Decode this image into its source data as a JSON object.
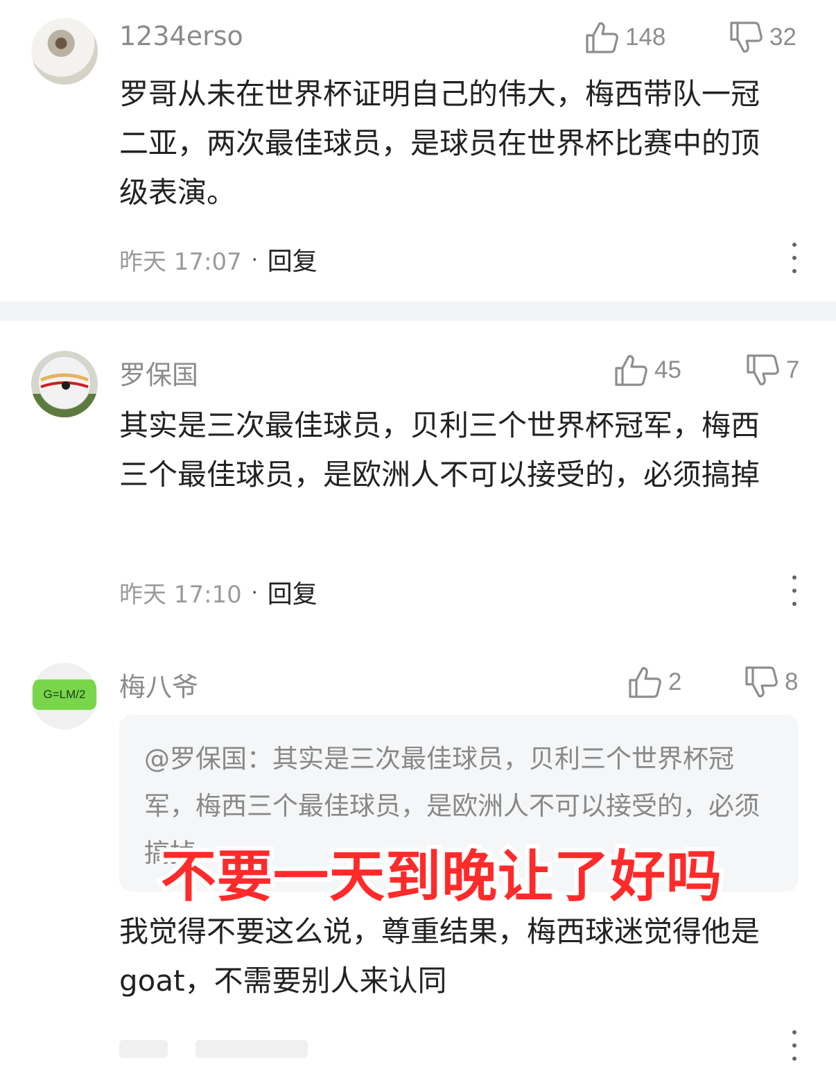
{
  "comments": [
    {
      "username": "1234erso",
      "likes": "148",
      "dislikes": "32",
      "text": "罗哥从未在世界杯证明自己的伟大，梅西带队一冠二亚，两次最佳球员，是球员在世界杯比赛中的顶级表演。",
      "time": "昨天 17:07",
      "reply_label": "回复",
      "separator": "·"
    },
    {
      "username": "罗保国",
      "likes": "45",
      "dislikes": "7",
      "text": "其实是三次最佳球员，贝利三个世界杯冠军，梅西三个最佳球员，是欧洲人不可以接受的，必须搞掉",
      "time": "昨天 17:10",
      "reply_label": "回复",
      "separator": "·"
    },
    {
      "username": "梅八爷",
      "avatar_badge": "G=LM/2",
      "likes": "2",
      "dislikes": "8",
      "quote": "@罗保国：其实是三次最佳球员，贝利三个世界杯冠军，梅西三个最佳球员，是欧洲人不可以接受的，必须搞掉",
      "text": "我觉得不要这么说，尊重结果，梅西球迷觉得他是 goat，不需要别人来认同"
    }
  ],
  "overlay_caption": "不要一天到晚让了好吗",
  "colors": {
    "accent_caption": "#ff2a2a",
    "meta_gray": "#9b9b9b",
    "divider": "#f2f3f5"
  },
  "icons": [
    "thumb-up-icon",
    "thumb-down-icon",
    "more-icon"
  ]
}
